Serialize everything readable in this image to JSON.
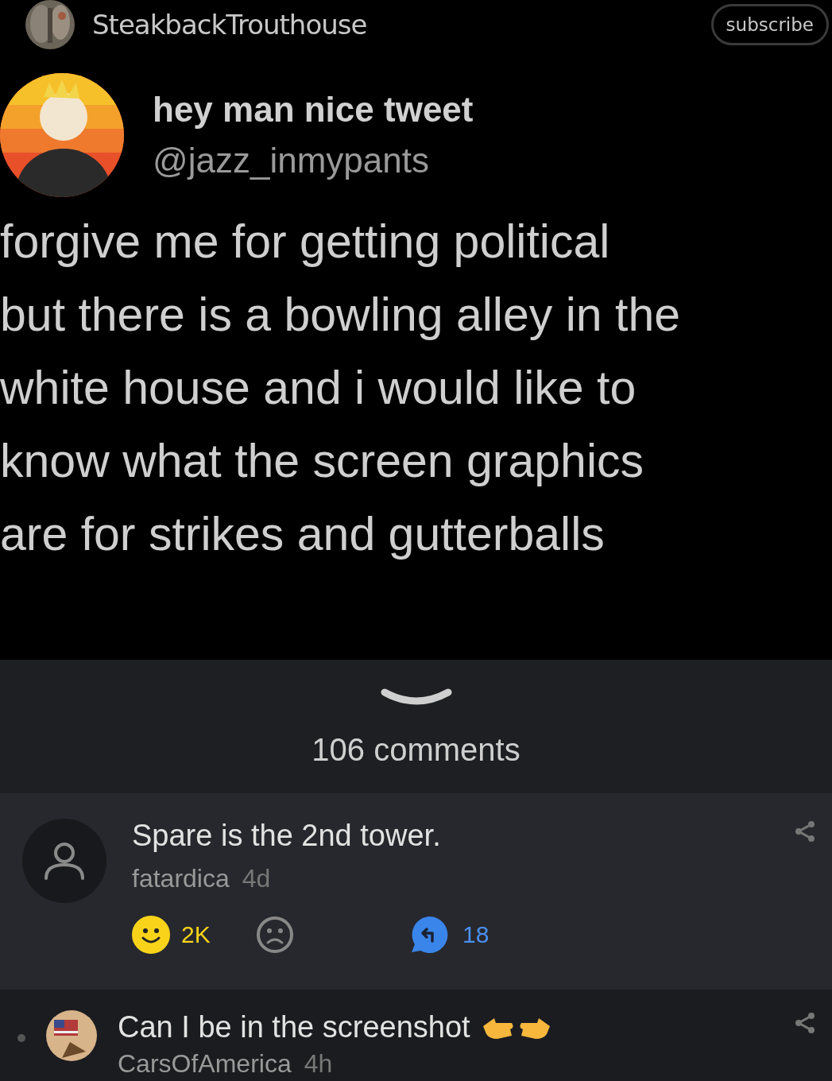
{
  "header": {
    "username": "SteakbackTrouthouse",
    "subscribe_button": "subscribe"
  },
  "tweet": {
    "display_name": "hey man nice tweet",
    "handle": "@jazz_inmypants",
    "body_lines": [
      "forgive me for getting political",
      "but there is a bowling alley in the",
      "white house and i would like to",
      "know what the screen graphics",
      "are for strikes and gutterballs"
    ]
  },
  "comments_header": {
    "count": "106 comments"
  },
  "comments": [
    {
      "kind": "expanded",
      "text": "Spare is the 2nd tower.",
      "author": "fatardica",
      "time": "4d",
      "likes": "2K",
      "replies": "18",
      "liked": true
    },
    {
      "kind": "reply",
      "text": "Can I be in the screenshot",
      "author": "CarsOfAmerica",
      "time": "4h"
    }
  ]
}
